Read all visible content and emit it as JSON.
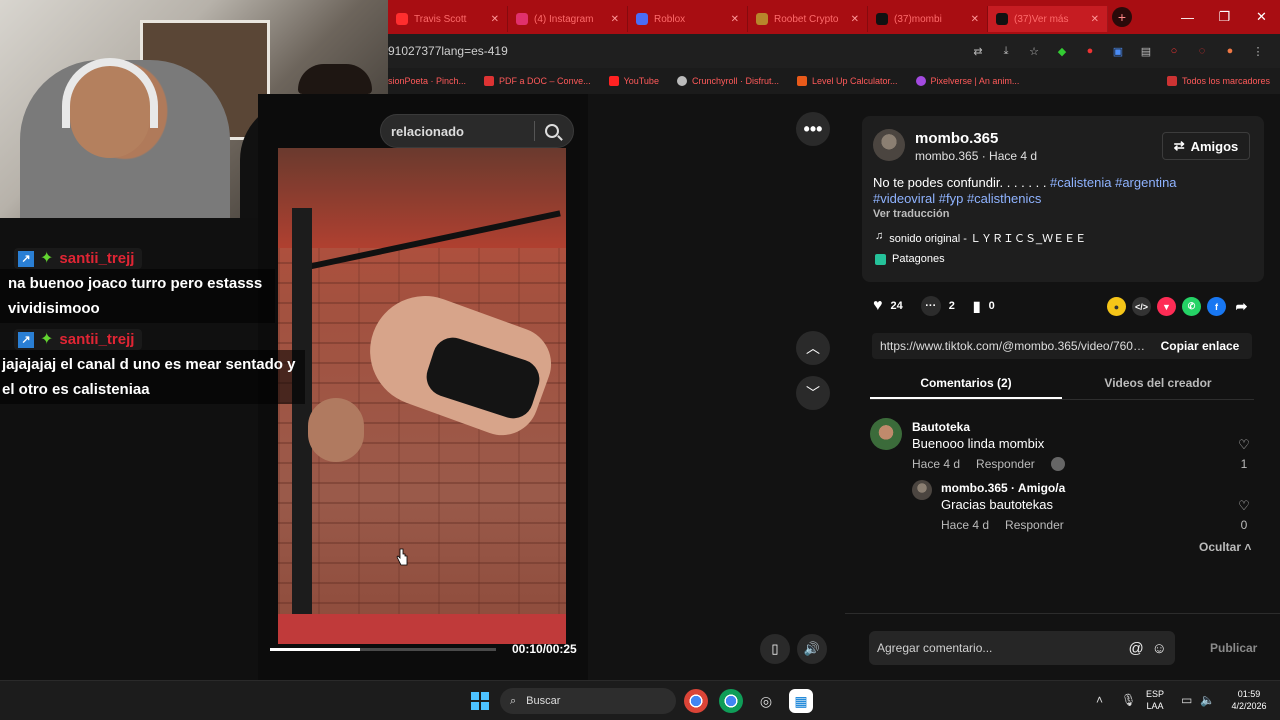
{
  "browser": {
    "tabs": [
      {
        "label": "Travis Scott",
        "color": "#ff2e2e",
        "icon": "youtube-icon"
      },
      {
        "label": "(4) Instagram",
        "color": "#e1306c",
        "icon": "instagram-icon"
      },
      {
        "label": "Roblox",
        "color": "#4a6cf7",
        "icon": "roblox-icon"
      },
      {
        "label": "Roobet Crypto",
        "color": "#b8862b",
        "icon": "roobet-icon"
      },
      {
        "label": "(37)mombi",
        "color": "#111111",
        "icon": "tiktok-icon"
      },
      {
        "label": "(37)Ver más",
        "color": "#111111",
        "icon": "tiktok-icon"
      }
    ],
    "url": "91027377lang=es-419",
    "bookmarks": [
      {
        "label": "sionPoeta · Pinch...",
        "icon": "bookmark-icon"
      },
      {
        "label": "PDF a DOC – Conve...",
        "icon": "pdf-icon"
      },
      {
        "label": "YouTube",
        "icon": "youtube-icon"
      },
      {
        "label": "Crunchyroll · Disfrut...",
        "icon": "crunchyroll-icon"
      },
      {
        "label": "Level Up Calculator...",
        "icon": "levelup-icon"
      },
      {
        "label": "Pixelverse | An anim...",
        "icon": "pixelverse-icon"
      }
    ],
    "bookmarks_all": "Todos los marcadores"
  },
  "chat": [
    {
      "user": "santii_trejj",
      "text": "na buenoo joaco turro pero estasss vividisimooo"
    },
    {
      "user": "santii_trejj",
      "text": "jajajajaj el canal d uno es mear sentado y el otro es calisteniaa"
    }
  ],
  "search": {
    "placeholder": "relacionado"
  },
  "video": {
    "time": "00:10/00:25",
    "progress": 0.4
  },
  "post": {
    "author": "mombo.365",
    "author_sub": "mombo.365 · Hace 4 d",
    "amigos_label": "Amigos",
    "desc_plain": "No te podes confundir. . . . . . . ",
    "hashtags_line1": "#calistenia #argentina",
    "hashtags_line2": "#videoviral #fyp #calisthenics",
    "translate": "Ver traducción",
    "sound": "sonido original - ＬＹＲＩＣＳ_ＷＥＥＥ",
    "place": "Patagones",
    "likes": "24",
    "comments": "2",
    "saves": "0",
    "link": "https://www.tiktok.com/@mombo.365/video/7601...",
    "copy_label": "Copiar enlace",
    "tab_comments": "Comentarios (2)",
    "tab_videos": "Videos del creador"
  },
  "comments": [
    {
      "name": "Bautoteka",
      "text": "Buenooo linda mombix",
      "time": "Hace 4 d",
      "reply": "Responder",
      "likes": "1"
    },
    {
      "name": "mombo.365 · Amigo/a",
      "text": "Gracias bautotekas",
      "time": "Hace 4 d",
      "reply": "Responder",
      "likes": "0"
    }
  ],
  "ocultar": "Ocultar",
  "composer": {
    "placeholder": "Agregar comentario...",
    "publish": "Publicar"
  },
  "taskbar": {
    "search": "Buscar",
    "lang1": "ESP",
    "lang2": "LAA",
    "time": "01:59",
    "date": "4/2/2026"
  }
}
